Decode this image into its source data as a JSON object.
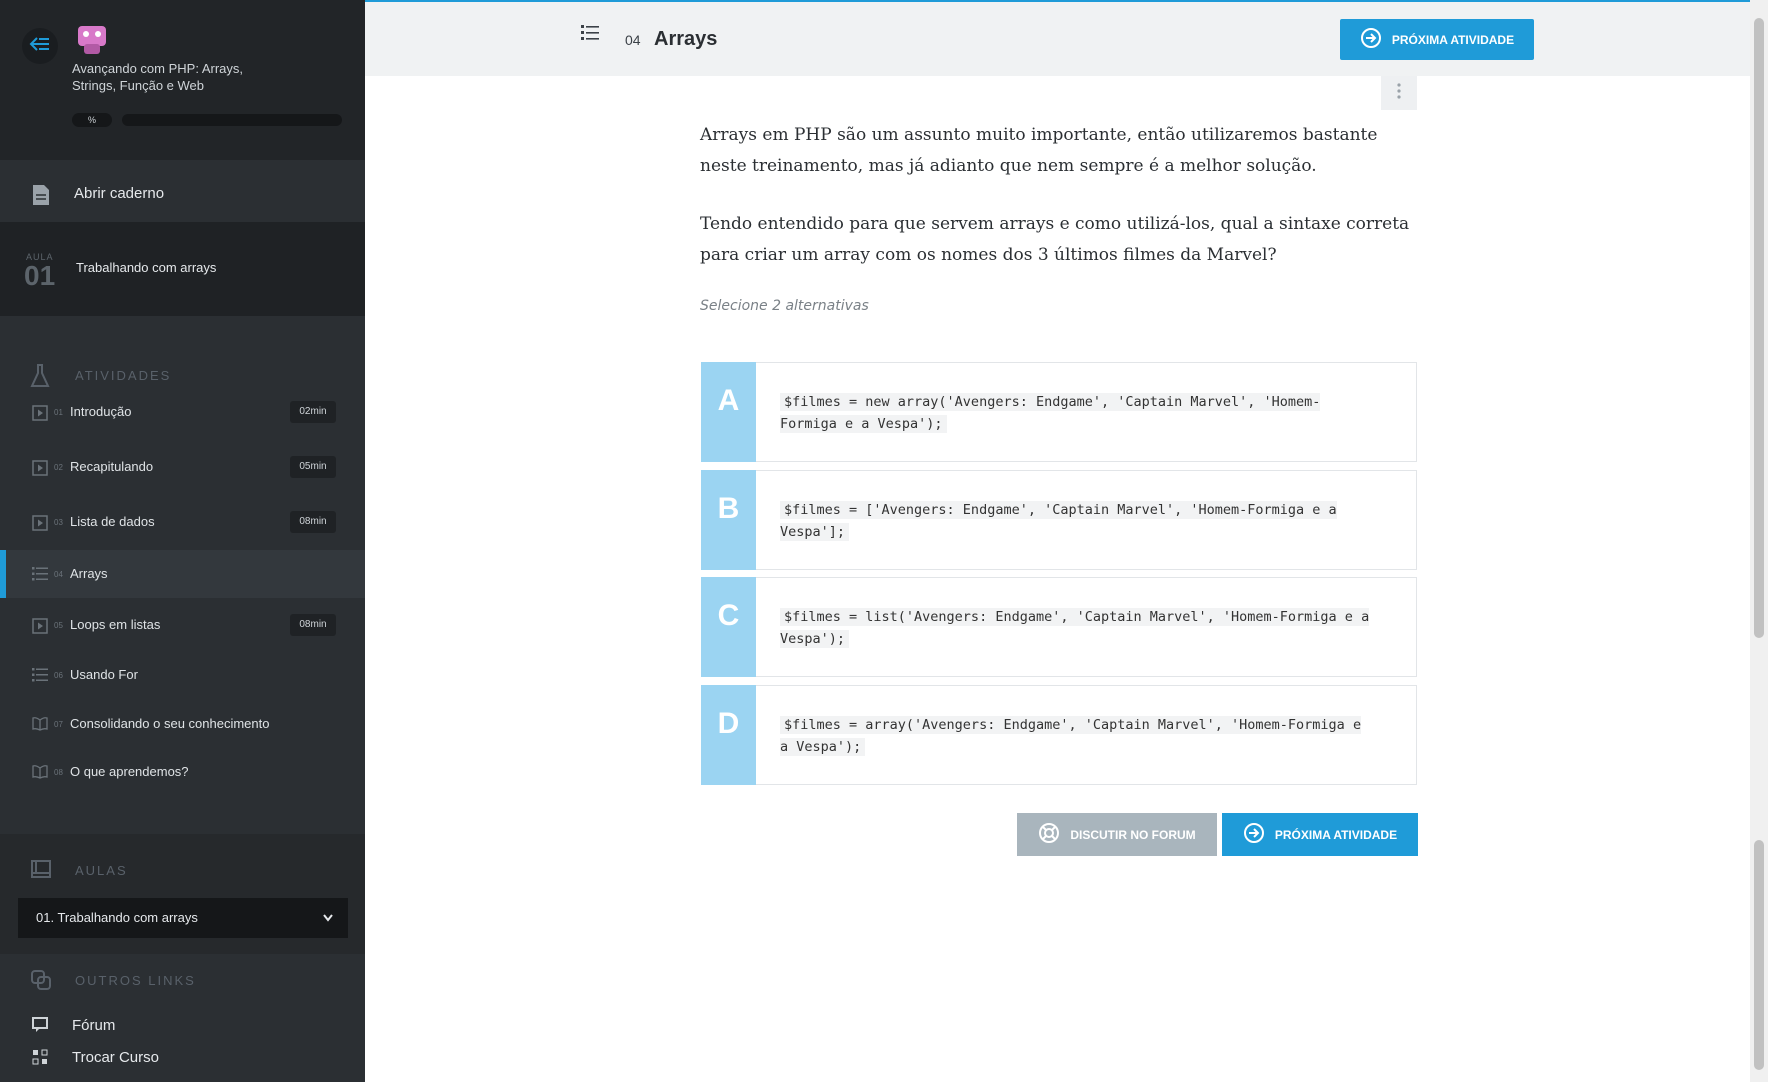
{
  "sidebar": {
    "course_title": "Avançando com PHP: Arrays, Strings, Função e Web",
    "progress_label": "%",
    "notebook_label": "Abrir caderno",
    "aula": {
      "caption": "AULA",
      "number": "01",
      "title": "Trabalhando com arrays"
    },
    "activities_header": "ATIVIDADES",
    "activities": [
      {
        "idx": "01",
        "label": "Introdução",
        "duration": "02min",
        "icon": "play-icon"
      },
      {
        "idx": "02",
        "label": "Recapitulando",
        "duration": "05min",
        "icon": "play-icon"
      },
      {
        "idx": "03",
        "label": "Lista de dados",
        "duration": "08min",
        "icon": "play-icon"
      },
      {
        "idx": "04",
        "label": "Arrays",
        "duration": "",
        "icon": "list-icon"
      },
      {
        "idx": "05",
        "label": "Loops em listas",
        "duration": "08min",
        "icon": "play-icon"
      },
      {
        "idx": "06",
        "label": "Usando For",
        "duration": "",
        "icon": "list-icon"
      },
      {
        "idx": "07",
        "label": "Consolidando o seu conhecimento",
        "duration": "",
        "icon": "book-icon"
      },
      {
        "idx": "08",
        "label": "O que aprendemos?",
        "duration": "",
        "icon": "book-icon"
      }
    ],
    "aulas_header": "AULAS",
    "aulas_selected": "01. Trabalhando com arrays",
    "links_header": "OUTROS LINKS",
    "links": [
      {
        "label": "Fórum"
      },
      {
        "label": "Trocar Curso"
      }
    ]
  },
  "topbar": {
    "number": "04",
    "title": "Arrays",
    "next_label": "PRÓXIMA ATIVIDADE"
  },
  "content": {
    "paragraph1": "Arrays em PHP são um assunto muito importante, então utilizaremos bastante neste treinamento, mas já adianto que nem sempre é a melhor solução.",
    "paragraph2": "Tendo entendido para que servem arrays e como utilizá-los, qual a sintaxe correta para criar um array com os nomes dos 3 últimos filmes da Marvel?",
    "hint": "Selecione 2 alternativas",
    "alternatives": [
      {
        "letter": "A",
        "code": "$filmes = new array('Avengers: Endgame', 'Captain Marvel', 'Homem-Formiga e a Vespa');"
      },
      {
        "letter": "B",
        "code": "$filmes = ['Avengers: Endgame', 'Captain Marvel', 'Homem-Formiga e a Vespa'];"
      },
      {
        "letter": "C",
        "code": "$filmes = list('Avengers: Endgame', 'Captain Marvel', 'Homem-Formiga e a Vespa');"
      },
      {
        "letter": "D",
        "code": "$filmes = array('Avengers: Endgame', 'Captain Marvel', 'Homem-Formiga e a Vespa');"
      }
    ],
    "forum_label": "DISCUTIR NO FORUM",
    "next_label": "PRÓXIMA ATIVIDADE"
  },
  "colors": {
    "accent": "#1f9bd8",
    "sidebar": "#2b2f33",
    "alt_letter": "#9bd4f2"
  }
}
